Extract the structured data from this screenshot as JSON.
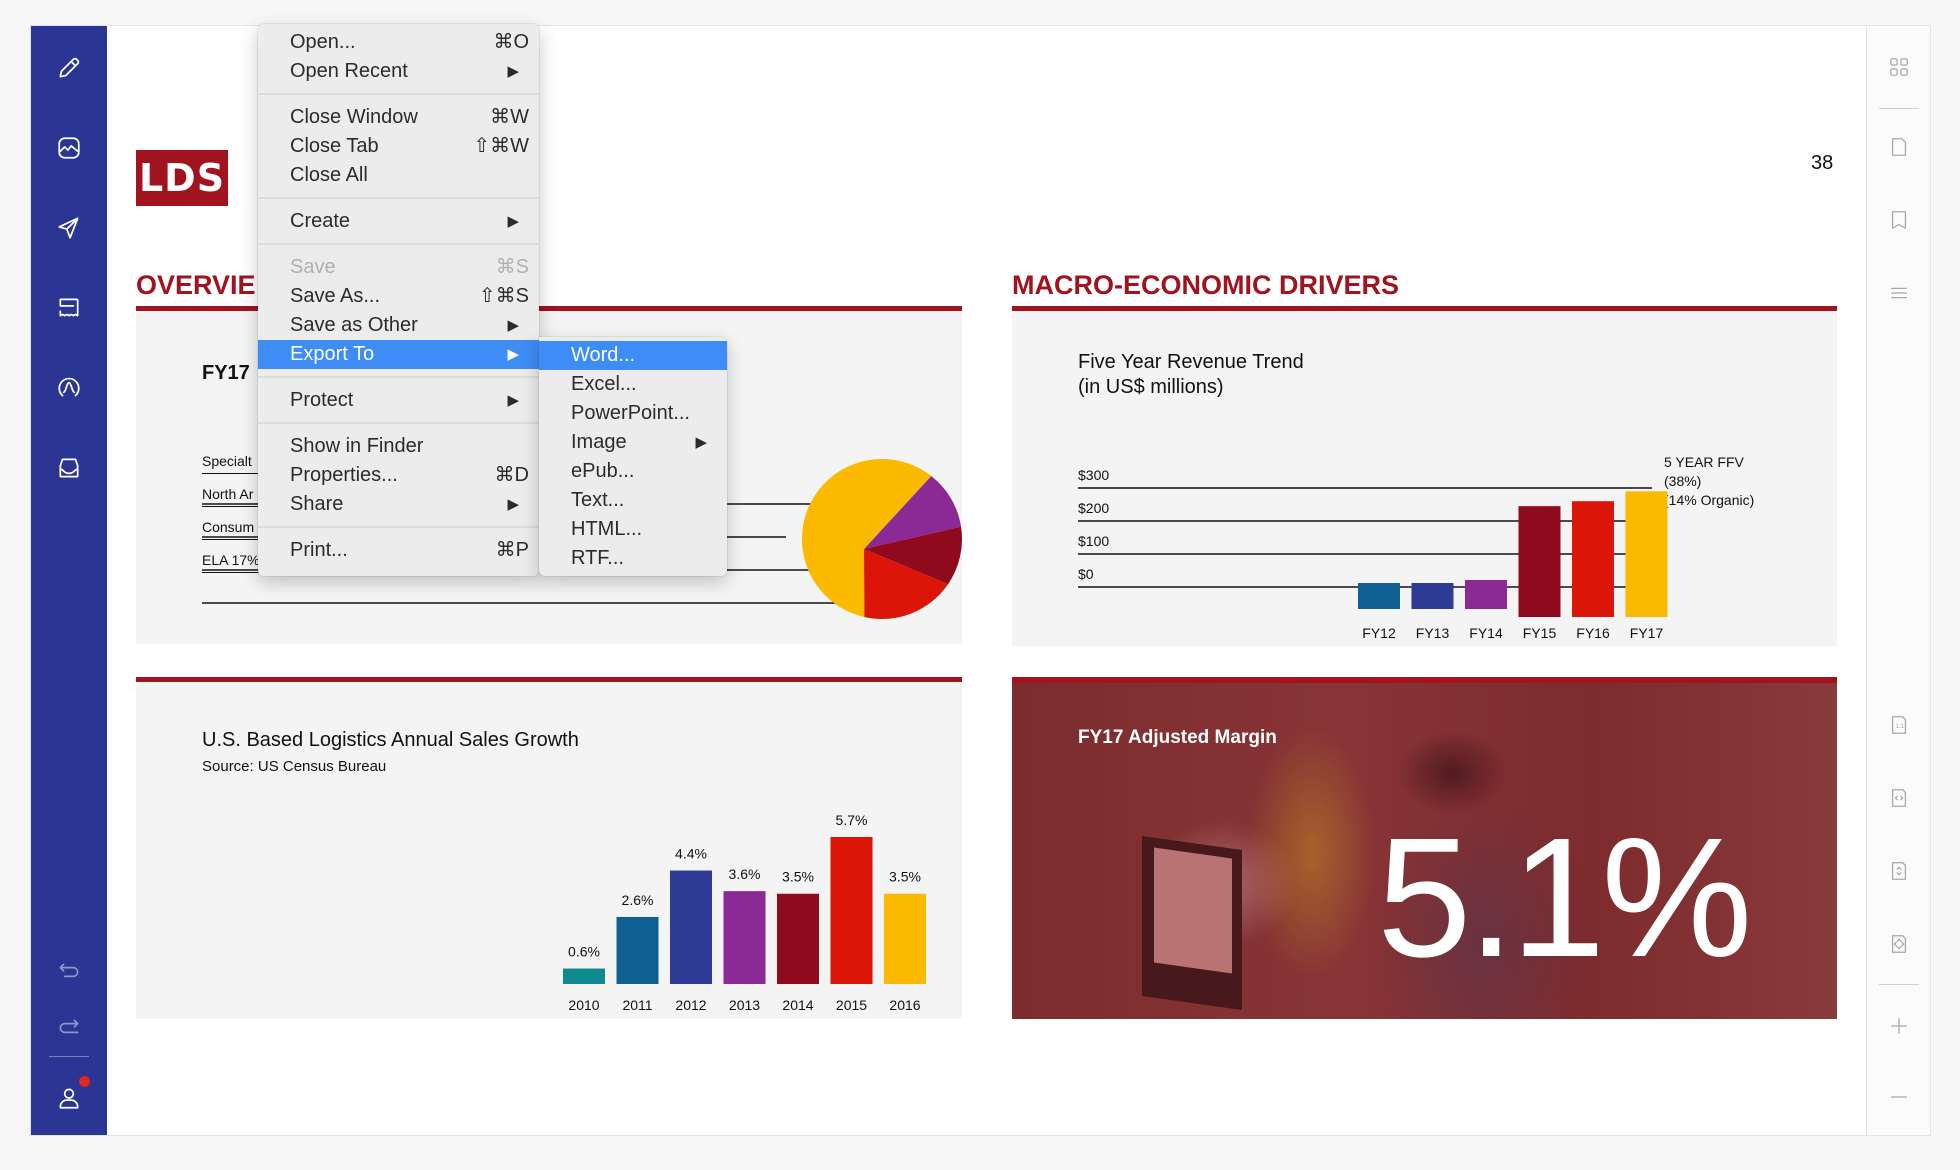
{
  "sidebar_left": {
    "items": [
      {
        "name": "edit",
        "icon": "pencil-icon"
      },
      {
        "name": "gallery",
        "icon": "image-icon"
      },
      {
        "name": "send",
        "icon": "send-icon"
      },
      {
        "name": "forms",
        "icon": "receipt-icon"
      },
      {
        "name": "signature",
        "icon": "signature-icon"
      },
      {
        "name": "inbox",
        "icon": "inbox-icon"
      }
    ],
    "bottom": [
      {
        "name": "undo",
        "icon": "undo-icon"
      },
      {
        "name": "redo",
        "icon": "redo-icon"
      },
      {
        "name": "account",
        "icon": "user-icon",
        "notification": true
      }
    ],
    "accent": "#2a3594",
    "notification_color": "#e6241c"
  },
  "sidebar_right": {
    "items": [
      "grid-view-icon",
      "page-icon",
      "bookmark-icon",
      "outline-icon"
    ],
    "zoom_items": [
      {
        "icon": "actual-size-icon",
        "glyph": "1:1"
      },
      {
        "icon": "fit-width-icon",
        "glyph": "<>"
      },
      {
        "icon": "fit-height-icon",
        "glyph": "^v"
      },
      {
        "icon": "fit-page-icon",
        "glyph": "<>^v"
      },
      {
        "icon": "zoom-in-icon",
        "glyph": "+"
      },
      {
        "icon": "zoom-out-icon",
        "glyph": "−"
      }
    ]
  },
  "document": {
    "logo": "LDS",
    "brand_color": "#a0131f",
    "page_number": "38",
    "overview": {
      "title": "OVERVIE",
      "fy_label": "FY17",
      "legend": [
        "Specialt",
        "North Ar",
        "Consum",
        "ELA 17%"
      ]
    },
    "macro": {
      "title": "MACRO-ECONOMIC DRIVERS"
    },
    "revenue_chart": {
      "title_line1": "Five Year Revenue Trend",
      "title_line2": "(in US$ millions)",
      "note_line1": "5 YEAR FFV",
      "note_line2": "(38%)",
      "note_line3": "(14% Organic)"
    },
    "sales_chart": {
      "title": "U.S. Based Logistics Annual Sales Growth",
      "source": "Source: US Census Bureau"
    },
    "margin": {
      "title": "FY17 Adjusted Margin",
      "value": "5.1%"
    }
  },
  "file_menu": {
    "items": [
      {
        "label": "Open...",
        "shortcut": "⌘O"
      },
      {
        "label": "Open Recent",
        "submenu": true
      },
      {
        "separator": true
      },
      {
        "label": "Close Window",
        "shortcut": "⌘W"
      },
      {
        "label": "Close Tab",
        "shortcut": "⇧⌘W"
      },
      {
        "label": "Close All"
      },
      {
        "separator": true
      },
      {
        "label": "Create",
        "submenu": true
      },
      {
        "separator": true
      },
      {
        "label": "Save",
        "shortcut": "⌘S",
        "disabled": true
      },
      {
        "label": "Save As...",
        "shortcut": "⇧⌘S"
      },
      {
        "label": "Save as Other",
        "submenu": true
      },
      {
        "label": "Export To",
        "submenu": true,
        "highlighted": true
      },
      {
        "separator": true
      },
      {
        "label": "Protect",
        "submenu": true
      },
      {
        "separator": true
      },
      {
        "label": "Show in Finder"
      },
      {
        "label": "Properties...",
        "shortcut": "⌘D"
      },
      {
        "label": "Share",
        "submenu": true
      },
      {
        "separator": true
      },
      {
        "label": "Print...",
        "shortcut": "⌘P"
      }
    ],
    "highlight_color": "#3e8cf5"
  },
  "export_submenu": {
    "items": [
      {
        "label": "Word...",
        "highlighted": true
      },
      {
        "label": "Excel..."
      },
      {
        "label": "PowerPoint..."
      },
      {
        "label": "Image",
        "submenu": true
      },
      {
        "label": "ePub..."
      },
      {
        "label": "Text..."
      },
      {
        "label": "HTML..."
      },
      {
        "label": "RTF..."
      }
    ]
  },
  "chart_data": [
    {
      "type": "pie",
      "title": "FY17",
      "categories": [
        "Yellow segment",
        "Purple segment",
        "Dark red segment",
        "Red segment"
      ],
      "values": [
        57,
        12,
        12,
        19
      ],
      "colors": [
        "#fbb900",
        "#8b2a94",
        "#8e0a1c",
        "#dc1509"
      ],
      "legend": [
        "Specialt",
        "North Ar",
        "Consum",
        "ELA 17%"
      ]
    },
    {
      "type": "bar",
      "title": "Five Year Revenue Trend (in US$ millions)",
      "categories": [
        "FY12",
        "FY13",
        "FY14",
        "FY15",
        "FY16",
        "FY17"
      ],
      "values": [
        -15,
        -15,
        -10,
        245,
        260,
        290
      ],
      "colors": [
        "#0f5f93",
        "#2d3a96",
        "#8b2a94",
        "#8e0a1c",
        "#dc1509",
        "#fbb900"
      ],
      "yticks": [
        "$0",
        "$100",
        "$200",
        "$300"
      ],
      "ylim": [
        -40,
        330
      ],
      "grid": true,
      "annotation": [
        "5 YEAR FFV",
        "(38%)",
        "(14% Organic)"
      ]
    },
    {
      "type": "bar",
      "title": "U.S. Based Logistics Annual Sales Growth",
      "subtitle": "Source: US Census Bureau",
      "categories": [
        "2010",
        "2011",
        "2012",
        "2013",
        "2014",
        "2015",
        "2016"
      ],
      "values": [
        0.6,
        2.6,
        4.4,
        3.6,
        3.5,
        5.7,
        3.5
      ],
      "labels": [
        "0.6%",
        "2.6%",
        "4.4%",
        "3.6%",
        "3.5%",
        "5.7%",
        "3.5%"
      ],
      "colors": [
        "#0f8a8f",
        "#0f5f93",
        "#2d3a96",
        "#8b2a94",
        "#8e0a1c",
        "#dc1509",
        "#fbb900"
      ],
      "ylim": [
        0,
        6
      ]
    }
  ]
}
